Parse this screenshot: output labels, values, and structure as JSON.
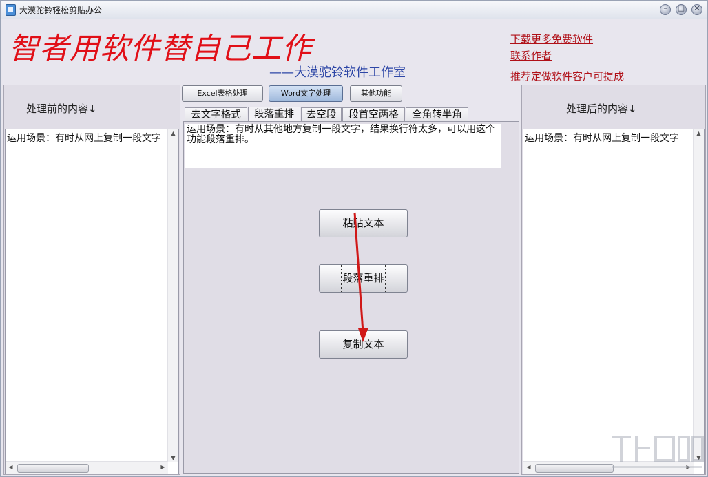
{
  "window": {
    "title": "大漠驼铃轻松剪贴办公",
    "controls": [
      "minimize",
      "maximize",
      "close"
    ]
  },
  "header": {
    "slogan": "智者用软件替自己工作",
    "studio": "——大漠驼铃软件工作室",
    "links": {
      "download": "下载更多免费软件",
      "contact": "联系作者",
      "recommend": "推荐定做软件客户可提成"
    }
  },
  "left_panel": {
    "title": "处理前的内容↓",
    "content": "运用场景：有时从网上复制一段文字"
  },
  "right_panel": {
    "title": "处理后的内容↓",
    "content": "运用场景：有时从网上复制一段文字"
  },
  "mode_buttons": [
    {
      "label": "Excel表格处理",
      "active": false
    },
    {
      "label": "Word文字处理",
      "active": true
    },
    {
      "label": "其他功能",
      "active": false
    }
  ],
  "tabs": [
    {
      "label": "去文字格式",
      "active": false
    },
    {
      "label": "段落重排",
      "active": true
    },
    {
      "label": "去空段",
      "active": false
    },
    {
      "label": "段首空两格",
      "active": false
    },
    {
      "label": "全角转半角",
      "active": false
    }
  ],
  "description": "运用场景：有时从其他地方复制一段文字，结果换行符太多，可以用这个功能段落重排。",
  "actions": {
    "paste": "粘贴文本",
    "reflow": "段落重排",
    "copy": "复制文本"
  },
  "colors": {
    "slogan": "#e10f17",
    "studio": "#2d46a6",
    "link": "#b01018",
    "annotation_arrow": "#d01818"
  },
  "icons": {
    "app": "document-icon",
    "scroll_up": "arrow-up-icon",
    "scroll_down": "arrow-down-icon",
    "scroll_left": "arrow-left-icon",
    "scroll_right": "arrow-right-icon"
  }
}
